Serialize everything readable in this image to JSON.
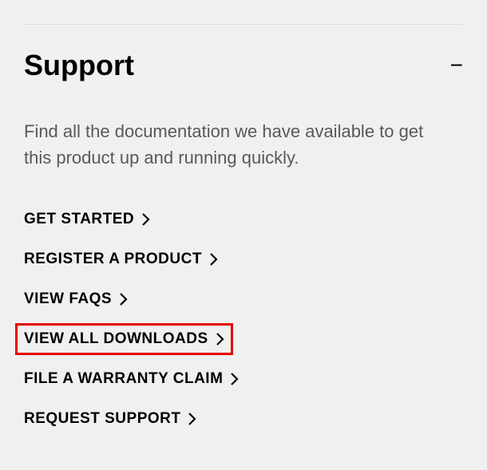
{
  "section": {
    "title": "Support",
    "description": "Find all the documentation we have available to get this product up and running quickly.",
    "links": [
      {
        "label": "GET STARTED"
      },
      {
        "label": "REGISTER A PRODUCT"
      },
      {
        "label": "VIEW FAQS"
      },
      {
        "label": "VIEW ALL DOWNLOADS"
      },
      {
        "label": "FILE A WARRANTY CLAIM"
      },
      {
        "label": "REQUEST SUPPORT"
      }
    ],
    "highlightedIndex": 3
  }
}
